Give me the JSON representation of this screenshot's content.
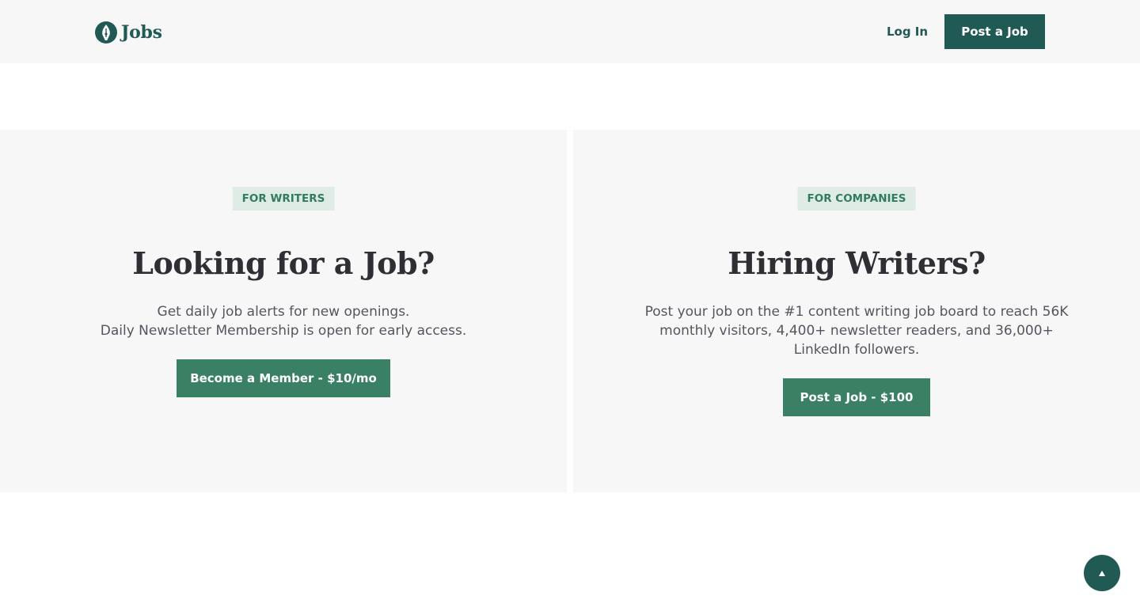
{
  "header": {
    "logo_text": "Jobs",
    "login_label": "Log In",
    "post_job_label": "Post a Job"
  },
  "writers": {
    "badge": "FOR WRITERS",
    "title": "Looking for a Job?",
    "desc_line1": "Get daily job alerts for new openings.",
    "desc_line2": "Daily Newsletter Membership is open for early access.",
    "cta_label": "Become a Member - $10/mo"
  },
  "companies": {
    "badge": "FOR COMPANIES",
    "title": "Hiring Writers?",
    "desc": "Post your job on the #1 content writing job board to reach 56K monthly visitors, 4,400+ newsletter readers, and 36,000+ LinkedIn followers.",
    "cta_label": "Post a Job - $100"
  },
  "icons": {
    "logo": "pen-nib-icon",
    "scroll_top": "arrow-up-icon"
  },
  "colors": {
    "brand_dark": "#215a55",
    "brand_green": "#3a8064",
    "badge_bg": "#dfece6",
    "panel_bg": "#f7f7f7"
  }
}
